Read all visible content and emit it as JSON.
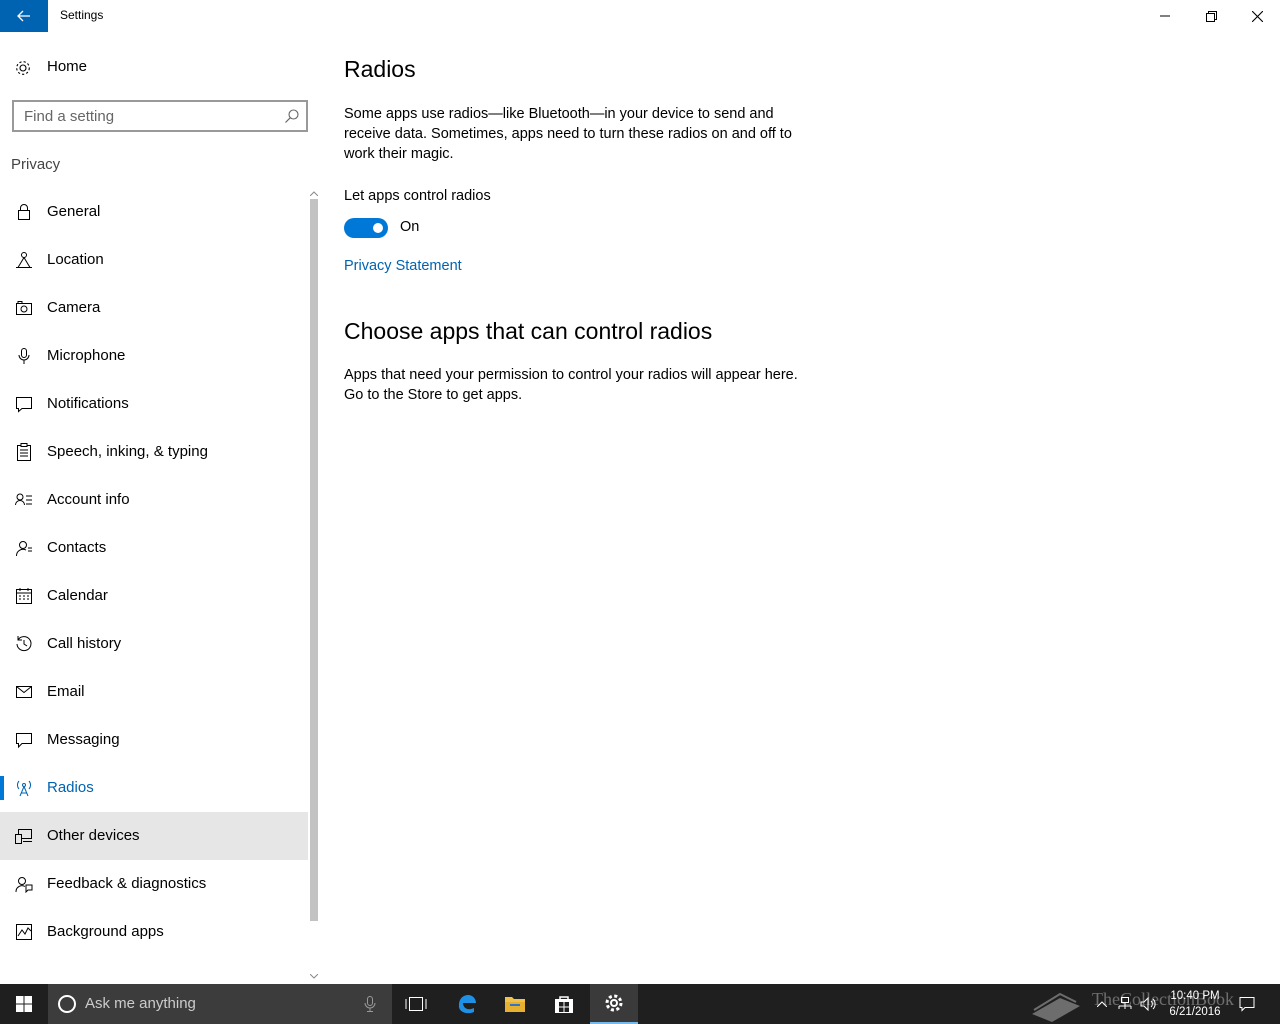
{
  "window": {
    "title": "Settings"
  },
  "sidebar": {
    "home_label": "Home",
    "search_placeholder": "Find a setting",
    "section": "Privacy",
    "items": [
      {
        "label": "General",
        "icon": "lock-icon"
      },
      {
        "label": "Location",
        "icon": "location-icon"
      },
      {
        "label": "Camera",
        "icon": "camera-icon"
      },
      {
        "label": "Microphone",
        "icon": "microphone-icon"
      },
      {
        "label": "Notifications",
        "icon": "notifications-icon"
      },
      {
        "label": "Speech, inking, & typing",
        "icon": "clipboard-icon"
      },
      {
        "label": "Account info",
        "icon": "account-info-icon"
      },
      {
        "label": "Contacts",
        "icon": "contacts-icon"
      },
      {
        "label": "Calendar",
        "icon": "calendar-icon"
      },
      {
        "label": "Call history",
        "icon": "history-icon"
      },
      {
        "label": "Email",
        "icon": "email-icon"
      },
      {
        "label": "Messaging",
        "icon": "messaging-icon"
      },
      {
        "label": "Radios",
        "icon": "radio-tower-icon",
        "selected": true
      },
      {
        "label": "Other devices",
        "icon": "other-devices-icon",
        "hovered": true
      },
      {
        "label": "Feedback & diagnostics",
        "icon": "feedback-icon"
      },
      {
        "label": "Background apps",
        "icon": "background-apps-icon"
      }
    ]
  },
  "main": {
    "title": "Radios",
    "description": "Some apps use radios—like Bluetooth—in your device to send and receive data. Sometimes, apps need to turn these radios on and off to work their magic.",
    "toggle_label": "Let apps control radios",
    "toggle_state": "On",
    "toggle_on": true,
    "privacy_link": "Privacy Statement",
    "subtitle": "Choose apps that can control radios",
    "subdescription": "Apps that need your permission to control your radios will appear here. Go to the Store to get apps."
  },
  "taskbar": {
    "search_placeholder": "Ask me anything",
    "time": "10:40 PM",
    "date": "6/21/2016",
    "watermark": "TheCollectionBook"
  },
  "colors": {
    "accent": "#0078d7",
    "link": "#0063b1",
    "taskbar": "#1f1f1f",
    "hover": "#e6e6e6"
  }
}
